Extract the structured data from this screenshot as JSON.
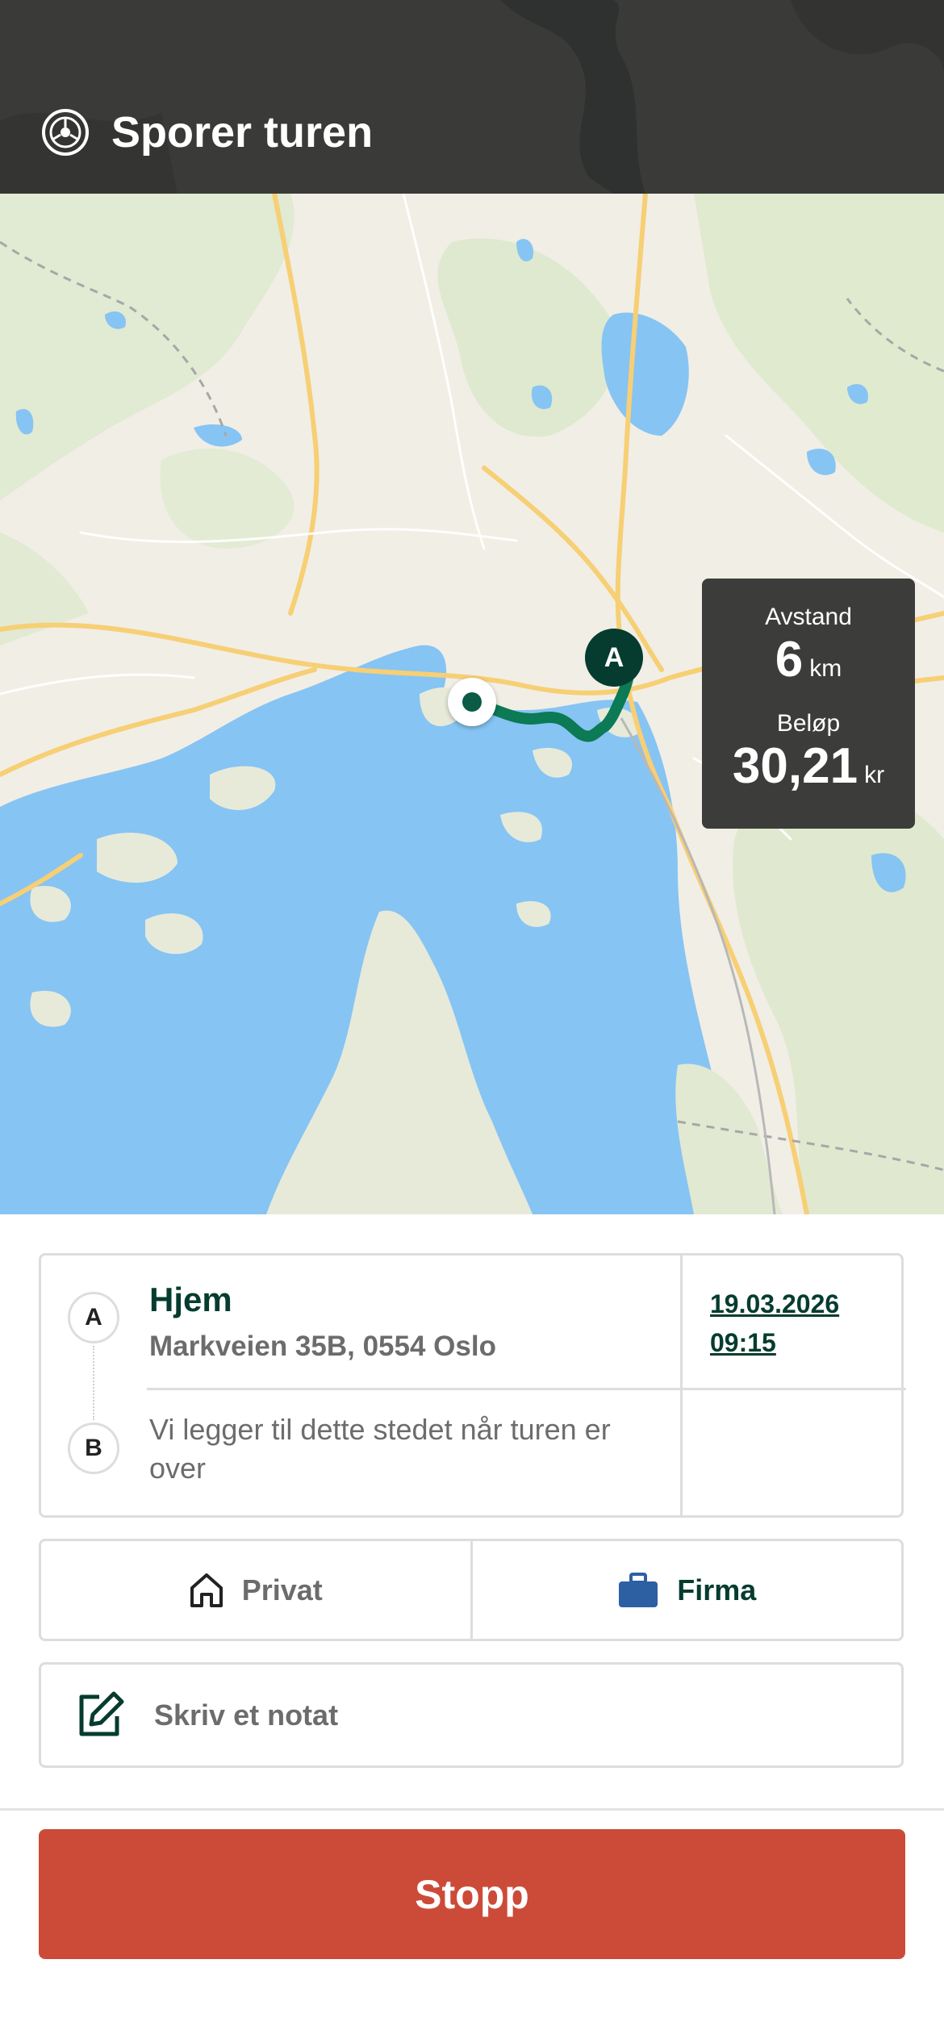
{
  "header": {
    "title": "Sporer turen",
    "icon": "steering-wheel-icon"
  },
  "map": {
    "start_marker_label": "A",
    "current_position_icon": "current-location-dot",
    "route_color": "#0b7a55"
  },
  "stats": {
    "distance_label": "Avstand",
    "distance_value": "6",
    "distance_unit": "km",
    "amount_label": "Beløp",
    "amount_value": "30,21",
    "amount_unit": "kr"
  },
  "route": {
    "from_badge": "A",
    "to_badge": "B",
    "from_name": "Hjem",
    "from_address": "Markveien 35B, 0554 Oslo",
    "to_placeholder": "Vi legger til dette stedet når turen er over",
    "start_date": "19.03.2026",
    "start_time": "09:15"
  },
  "trip_type": {
    "private_label": "Privat",
    "company_label": "Firma",
    "selected": "Firma"
  },
  "note": {
    "placeholder": "Skriv et notat"
  },
  "actions": {
    "stop_label": "Stopp"
  },
  "colors": {
    "header_bg": "#3a3b39",
    "brand_green": "#063c2f",
    "stop_red": "#cc4b38",
    "company_blue": "#2d5fa3"
  }
}
